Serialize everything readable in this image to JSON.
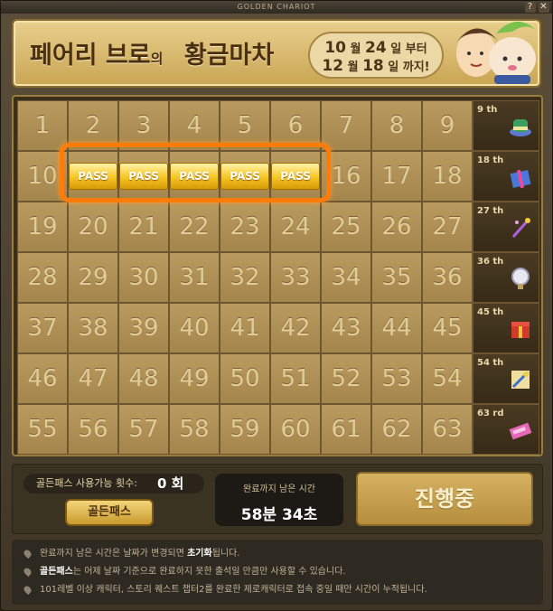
{
  "window": {
    "title": "GOLDEN CHARIOT",
    "help_glyph": "?",
    "close_glyph": "✕"
  },
  "header": {
    "title_part1": "페어리 브로",
    "title_part2": "의",
    "title_part3": "황금마차",
    "date_line1_month": "10",
    "date_line1_month_unit": "월",
    "date_line1_day": "24",
    "date_line1_suffix": "일 부터",
    "date_line2_month": "12",
    "date_line2_month_unit": "월",
    "date_line2_day": "18",
    "date_line2_suffix": "일 까지!"
  },
  "board": {
    "cells": [
      "1",
      "2",
      "3",
      "4",
      "5",
      "6",
      "7",
      "8",
      "9",
      "10",
      "PASS",
      "PASS",
      "PASS",
      "PASS",
      "PASS",
      "16",
      "17",
      "18",
      "19",
      "20",
      "21",
      "22",
      "23",
      "24",
      "25",
      "26",
      "27",
      "28",
      "29",
      "30",
      "31",
      "32",
      "33",
      "34",
      "35",
      "36",
      "37",
      "38",
      "39",
      "40",
      "41",
      "42",
      "43",
      "44",
      "45",
      "46",
      "47",
      "48",
      "49",
      "50",
      "51",
      "52",
      "53",
      "54",
      "55",
      "56",
      "57",
      "58",
      "59",
      "60",
      "61",
      "62",
      "63"
    ],
    "rewards": [
      {
        "label": "9 th",
        "icon": "green-hat-icon"
      },
      {
        "label": "18 th",
        "icon": "gift-box-icon"
      },
      {
        "label": "27 th",
        "icon": "magic-wand-icon"
      },
      {
        "label": "36 th",
        "icon": "mirror-icon"
      },
      {
        "label": "45 th",
        "icon": "red-box-icon"
      },
      {
        "label": "54 th",
        "icon": "scroll-icon"
      },
      {
        "label": "63 rd",
        "icon": "ticket-icon"
      }
    ]
  },
  "bottom": {
    "uses_label": "골든패스 사용가능 횟수:",
    "uses_count": "0 회",
    "golden_pass_button": "골든패스",
    "time_label": "완료까지 남은 시간",
    "time_value": "58분 34초",
    "progress_button": "진행중"
  },
  "notes": {
    "n1_pre": "완료까지 남은 시간은 날짜가 변경되면 ",
    "n1_bold": "초기화",
    "n1_post": "됩니다.",
    "n2_bold": "골든패스",
    "n2_post": "는 어제 날짜 기준으로 완료하지 못한 출석일 만큼만 사용할 수 있습니다.",
    "n3": "101레벨 이상 캐릭터, 스토리 퀘스트 챕터2를 완료한 제로캐릭터로 접속 중일 때만 시간이 누적됩니다."
  }
}
